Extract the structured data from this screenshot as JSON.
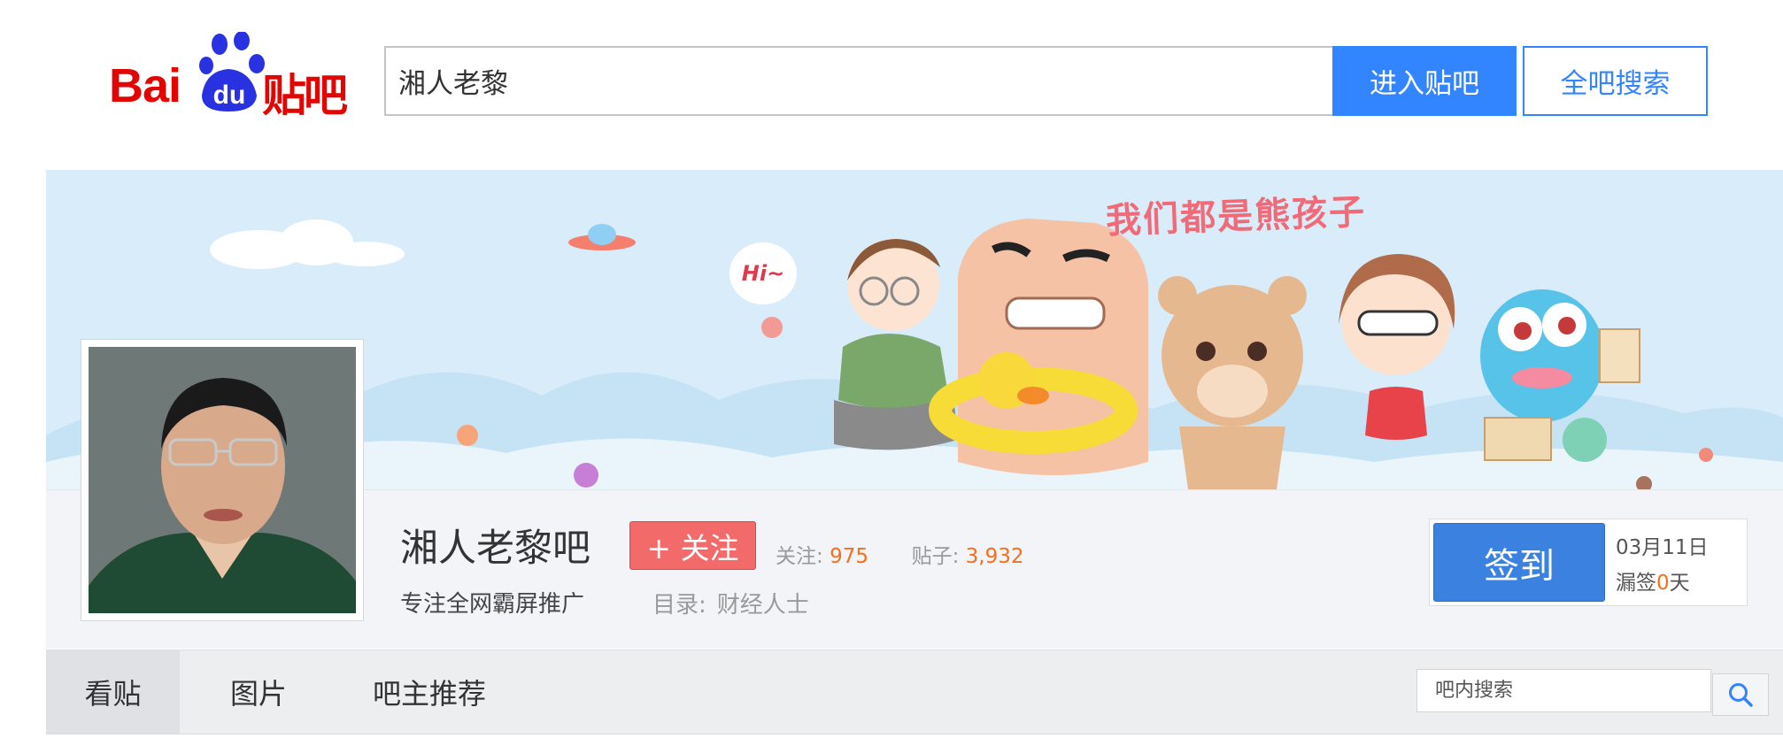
{
  "header": {
    "logo_text": "Bai",
    "logo_paw_text": "du",
    "logo_product": "贴吧",
    "search_value": "湘人老黎",
    "enter_button": "进入贴吧",
    "global_search_button": "全吧搜索"
  },
  "banner": {
    "slogan": "我们都是熊孩子",
    "bubble": "Hi~"
  },
  "forum": {
    "name": "湘人老黎吧",
    "follow_button": "+ 关注",
    "followers_label": "关注:",
    "followers_value": "975",
    "posts_label": "贴子:",
    "posts_value": "3,932",
    "slogan": "专注全网霸屏推广",
    "catalog_label": "目录:",
    "catalog_value": "财经人士"
  },
  "sign": {
    "button": "签到",
    "date": "03月11日",
    "missed_prefix": "漏签",
    "missed_count": "0",
    "missed_suffix": "天"
  },
  "tabs": [
    {
      "label": "看贴",
      "active": true
    },
    {
      "label": "图片",
      "active": false
    },
    {
      "label": "吧主推荐",
      "active": false
    }
  ],
  "forum_search": {
    "placeholder": "吧内搜索"
  },
  "colors": {
    "brand_red": "#e10602",
    "brand_blue": "#2932e1",
    "primary": "#3385ff",
    "follow": "#f26a6a",
    "number": "#f86e1c"
  },
  "icons": [
    "baidu-paw-icon",
    "search-icon"
  ]
}
